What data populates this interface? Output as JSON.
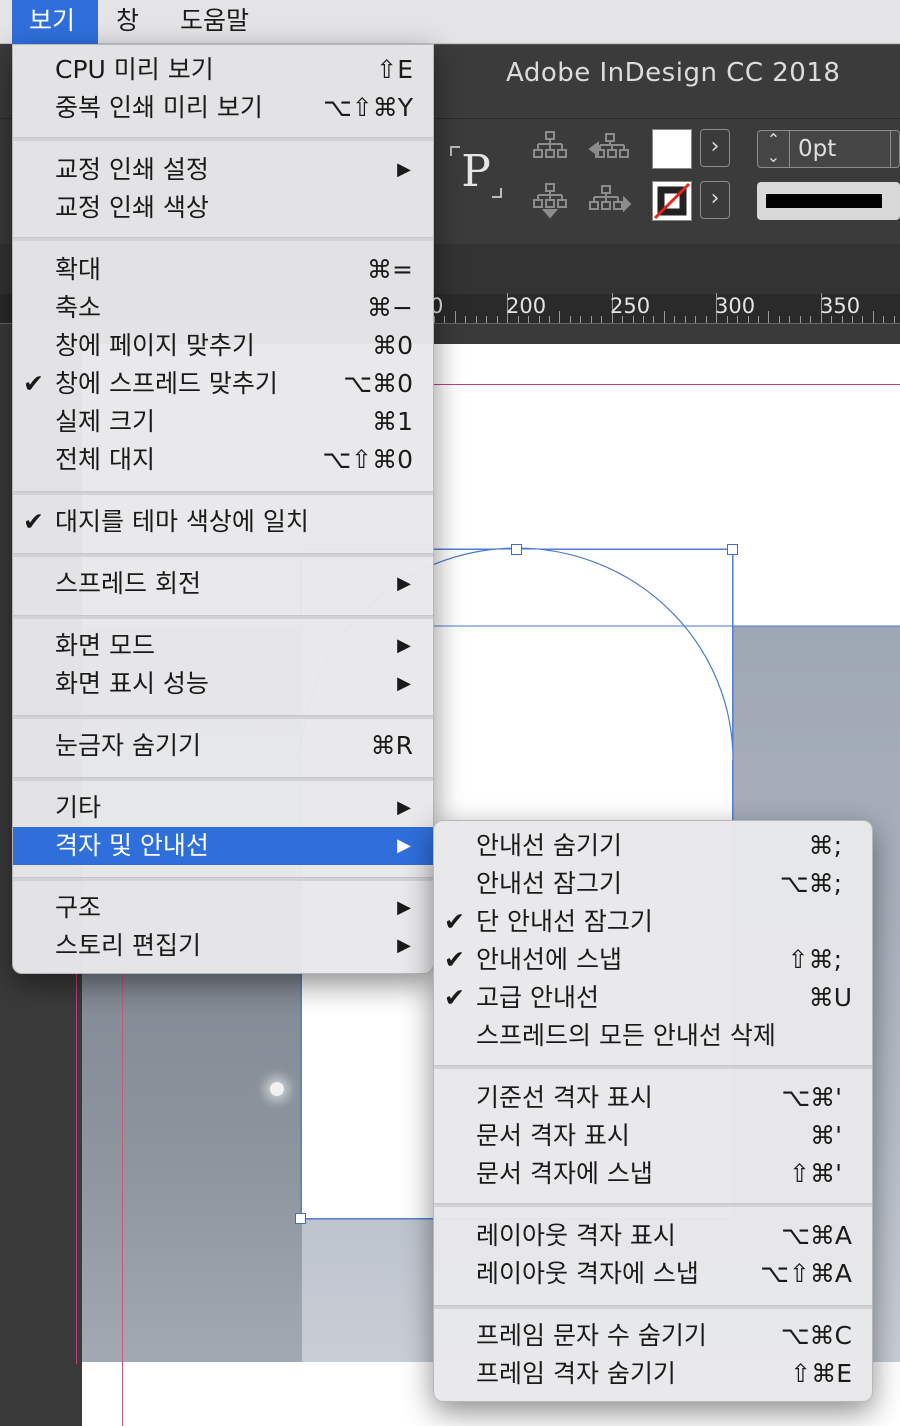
{
  "menubar": {
    "items": [
      {
        "label": "보기",
        "active": true
      },
      {
        "label": "창"
      },
      {
        "label": "도움말"
      }
    ]
  },
  "app": {
    "title": "Adobe InDesign CC 2018"
  },
  "control_bar": {
    "frame_type_glyph": "P",
    "stroke_weight": "0pt",
    "fill_color": "#ffffff",
    "stroke_color": "none",
    "swatch_menu_arrow": "›",
    "stepper_up": "⌃",
    "stepper_down": "⌄",
    "align_icons": [
      "distribute-top-icon",
      "distribute-left-icon",
      "distribute-bottom-icon",
      "distribute-right-icon"
    ]
  },
  "ruler": {
    "labels": [
      "0",
      "200",
      "250",
      "300",
      "350"
    ]
  },
  "menu": {
    "check_glyph": "✔",
    "arrow_glyph": "▶",
    "items": [
      {
        "label": "CPU 미리 보기",
        "shortcut": "⇧E"
      },
      {
        "label": "중복 인쇄 미리 보기",
        "shortcut": "⌥⇧⌘Y"
      },
      {
        "label": "교정 인쇄 설정",
        "submenu": true
      },
      {
        "label": "교정 인쇄 색상"
      },
      {
        "label": "확대",
        "shortcut": "⌘="
      },
      {
        "label": "축소",
        "shortcut": "⌘−"
      },
      {
        "label": "창에 페이지 맞추기",
        "shortcut": "⌘0"
      },
      {
        "label": "창에 스프레드 맞추기",
        "shortcut": "⌥⌘0",
        "checked": true
      },
      {
        "label": "실제 크기",
        "shortcut": "⌘1"
      },
      {
        "label": "전체 대지",
        "shortcut": "⌥⇧⌘0"
      },
      {
        "label": "대지를 테마 색상에 일치",
        "checked": true
      },
      {
        "label": "스프레드 회전",
        "submenu": true
      },
      {
        "label": "화면 모드",
        "submenu": true
      },
      {
        "label": "화면 표시 성능",
        "submenu": true
      },
      {
        "label": "눈금자 숨기기",
        "shortcut": "⌘R"
      },
      {
        "label": "기타",
        "submenu": true
      },
      {
        "label": "격자 및 안내선",
        "submenu": true,
        "highlighted": true
      },
      {
        "label": "구조",
        "submenu": true
      },
      {
        "label": "스토리 편집기",
        "submenu": true
      }
    ]
  },
  "submenu": {
    "items": [
      {
        "label": "안내선 숨기기",
        "shortcut": "⌘;"
      },
      {
        "label": "안내선 잠그기",
        "shortcut": "⌥⌘;"
      },
      {
        "label": "단 안내선 잠그기",
        "checked": true
      },
      {
        "label": "안내선에 스냅",
        "shortcut": "⇧⌘;",
        "checked": true
      },
      {
        "label": "고급 안내선",
        "shortcut": "⌘U",
        "checked": true
      },
      {
        "label": "스프레드의 모든 안내선 삭제"
      },
      {
        "label": "기준선 격자 표시",
        "shortcut": "⌥⌘'"
      },
      {
        "label": "문서 격자 표시",
        "shortcut": "⌘'"
      },
      {
        "label": "문서 격자에 스냅",
        "shortcut": "⇧⌘'"
      },
      {
        "label": "레이아웃 격자 표시",
        "shortcut": "⌥⌘A"
      },
      {
        "label": "레이아웃 격자에 스냅",
        "shortcut": "⌥⇧⌘A"
      },
      {
        "label": "프레임 문자 수 숨기기",
        "shortcut": "⌥⌘C"
      },
      {
        "label": "프레임 격자 숨기기",
        "shortcut": "⇧⌘E"
      }
    ]
  }
}
